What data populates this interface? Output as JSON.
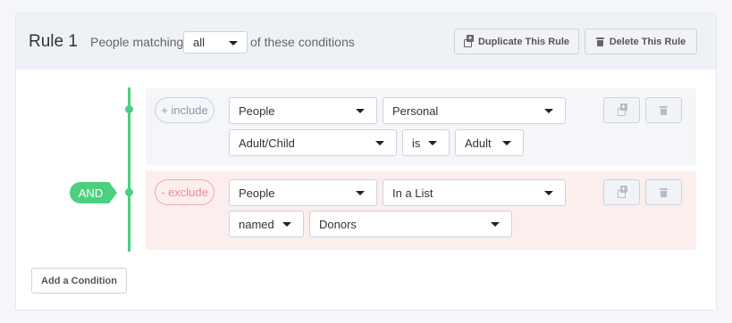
{
  "rule": {
    "title": "Rule 1",
    "prefix_text": "People matching",
    "match_mode": "all",
    "suffix_text": "of these conditions",
    "duplicate_label": "Duplicate This Rule",
    "delete_label": "Delete This Rule"
  },
  "connector": {
    "label": "AND",
    "color": "#4cd080"
  },
  "conditions": [
    {
      "type_label": "+ include",
      "row1": {
        "field": "People",
        "category": "Personal"
      },
      "row2": {
        "attribute": "Adult/Child",
        "operator": "is",
        "value": "Adult"
      }
    },
    {
      "type_label": "- exclude",
      "row1": {
        "field": "People",
        "category": "In a List"
      },
      "row2": {
        "qualifier": "named",
        "value": "Donors"
      }
    }
  ],
  "add_condition_label": "Add a Condition",
  "icons": {
    "duplicate": "duplicate-icon",
    "delete": "trash-icon"
  },
  "colors": {
    "include_bg": "#f4f6fa",
    "exclude_bg": "#fdeeee",
    "exclude_accent": "#e88c8c"
  }
}
